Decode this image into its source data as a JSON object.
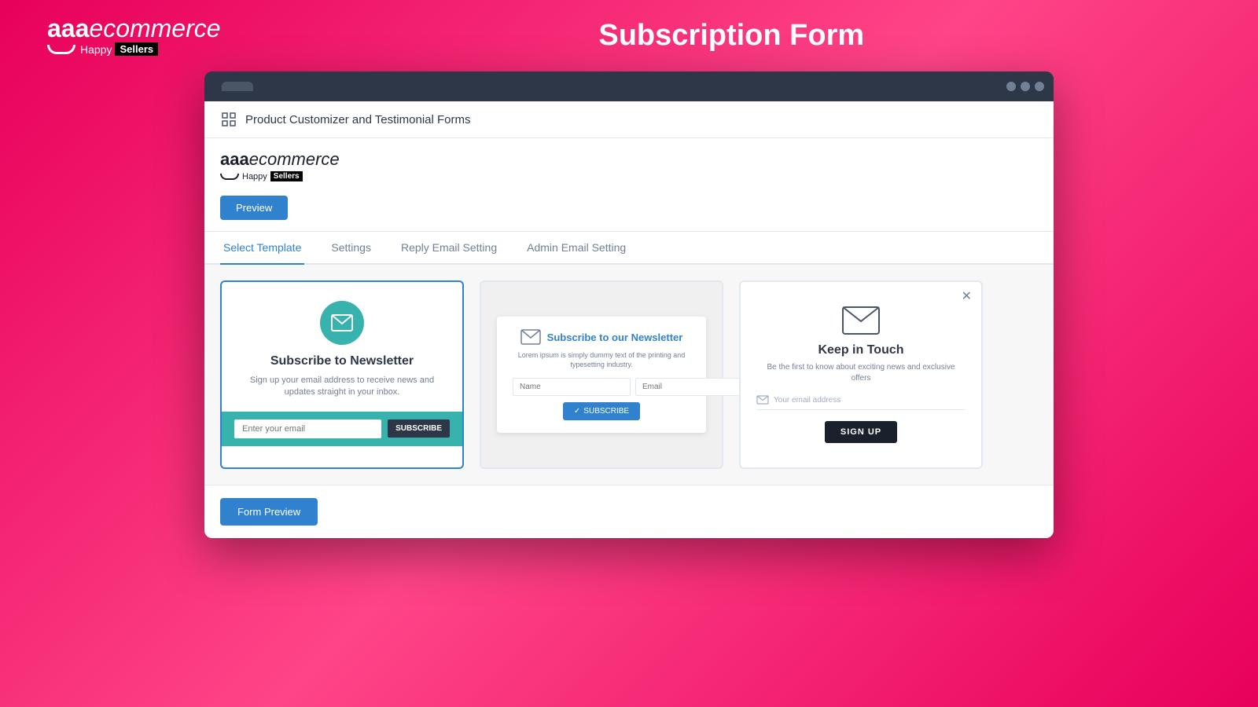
{
  "header": {
    "brand": "aaa",
    "brand_italic": "ecommerce",
    "happy": "Happy",
    "sellers": "Sellers",
    "page_title": "Subscription Form"
  },
  "browser": {
    "tab_label": "",
    "dots": [
      "dot1",
      "dot2",
      "dot3"
    ]
  },
  "app": {
    "icon": "⊞",
    "title": "Product Customizer and Testimonial Forms",
    "logo_brand": "aaa",
    "logo_italic": "ecommerce",
    "logo_happy": "Happy",
    "logo_sellers": "Sellers"
  },
  "toolbar": {
    "preview_label": "Preview"
  },
  "tabs": [
    {
      "id": "select-template",
      "label": "Select Template",
      "active": true
    },
    {
      "id": "settings",
      "label": "Settings",
      "active": false
    },
    {
      "id": "reply-email",
      "label": "Reply Email Setting",
      "active": false
    },
    {
      "id": "admin-email",
      "label": "Admin Email Setting",
      "active": false
    }
  ],
  "templates": [
    {
      "id": "template-1",
      "selected": true,
      "title": "Subscribe to Newsletter",
      "description": "Sign up your email address to receive news and updates straight in your inbox.",
      "email_placeholder": "Enter your email",
      "subscribe_btn": "SUBSCRIBE",
      "accent_color": "#38b2ac"
    },
    {
      "id": "template-2",
      "selected": false,
      "title": "Subscribe to our Newsletter",
      "description": "Lorem ipsum is simply dummy text of the printing and typesetting industry.",
      "name_placeholder": "Name",
      "email_placeholder": "Email",
      "subscribe_btn": "SUBSCRIBE"
    },
    {
      "id": "template-3",
      "selected": false,
      "title": "Keep in Touch",
      "description": "Be the first to know about exciting news and exclusive offers",
      "email_placeholder": "Your email address",
      "signup_btn": "SIGN UP",
      "has_close": true
    }
  ],
  "bottom": {
    "form_preview_btn": "Form Preview"
  }
}
